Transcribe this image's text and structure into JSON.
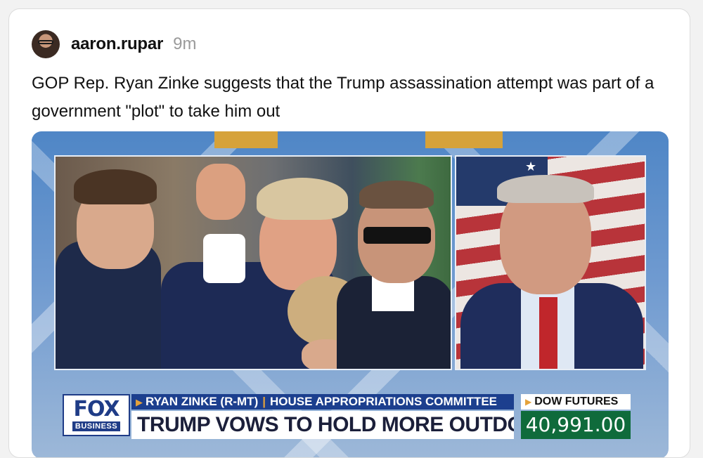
{
  "post": {
    "username": "aaron.rupar",
    "timestamp": "9m",
    "text": "GOP Rep. Ryan Zinke suggests that the Trump assassination attempt was part of a government \"plot\" to take him out"
  },
  "video": {
    "network_logo": "FOX",
    "network_sub": "BUSINESS",
    "lower_third_name": "RYAN ZINKE (R-MT)",
    "lower_third_role": "HOUSE APPROPRIATIONS COMMITTEE",
    "headline": "TRUMP VOWS TO HOLD MORE OUTDOOR RALLIES",
    "ticker_label": "DOW FUTURES",
    "ticker_value": "40,991.00"
  },
  "colors": {
    "fox_blue": "#1f3c87",
    "ticker_green": "#0f6b3b",
    "accent_gold": "#e4a23a"
  }
}
